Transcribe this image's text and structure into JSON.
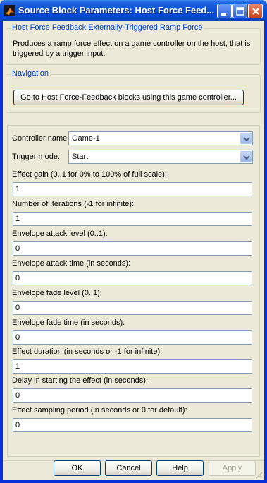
{
  "window": {
    "title": "Source Block Parameters: Host Force Feed...",
    "minimize_icon": "minimize-icon",
    "maximize_icon": "maximize-icon",
    "close_icon": "close-icon",
    "app_icon": "matlab-icon"
  },
  "description": {
    "title": "Host Force Feedback Externally-Triggered Ramp Force",
    "text": "Produces a ramp force effect on a game controller on the host, that is triggered by a trigger input."
  },
  "navigation": {
    "title": "Navigation",
    "button_label": "Go to Host Force-Feedback blocks using this game controller..."
  },
  "parameters": {
    "controller_name": {
      "label": "Controller name:",
      "value": "Game-1"
    },
    "trigger_mode": {
      "label": "Trigger mode:",
      "value": "Start"
    },
    "fields": [
      {
        "label": "Effect gain (0..1 for 0% to 100% of full scale):",
        "value": "1"
      },
      {
        "label": "Number of iterations (-1 for infinite):",
        "value": "1"
      },
      {
        "label": "Envelope attack level (0..1):",
        "value": "0"
      },
      {
        "label": "Envelope attack time (in seconds):",
        "value": "0"
      },
      {
        "label": "Envelope fade level (0..1):",
        "value": "0"
      },
      {
        "label": "Envelope fade time (in seconds):",
        "value": "0"
      },
      {
        "label": "Effect duration (in seconds or -1 for infinite):",
        "value": "1"
      },
      {
        "label": "Delay in starting the effect (in seconds):",
        "value": "0"
      },
      {
        "label": "Effect sampling period (in seconds or 0 for default):",
        "value": "0"
      }
    ]
  },
  "buttons": {
    "ok": "OK",
    "cancel": "Cancel",
    "help": "Help",
    "apply": "Apply"
  },
  "colors": {
    "title_bar": "#0A50D8",
    "group_title": "#0046D5",
    "dialog_bg": "#ECE9D8"
  }
}
